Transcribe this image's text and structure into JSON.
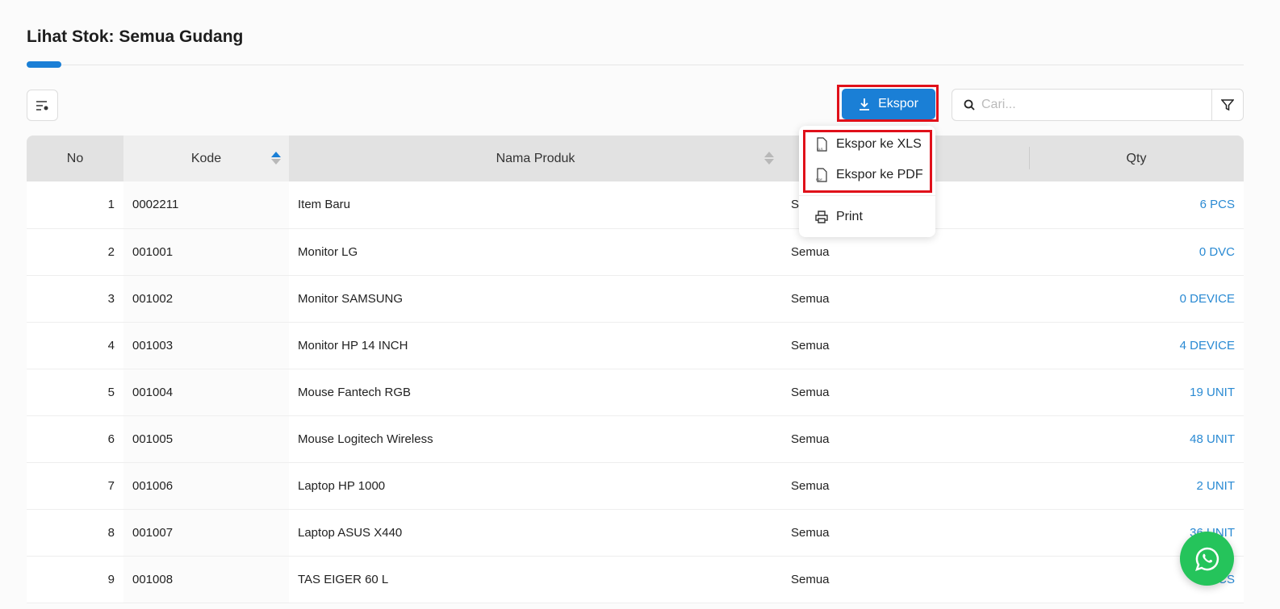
{
  "page": {
    "title": "Lihat Stok: Semua Gudang"
  },
  "toolbar": {
    "export_label": "Ekspor",
    "search_placeholder": "Cari...",
    "accent": "#1a7fd6"
  },
  "export_menu": {
    "items": [
      {
        "label": "Ekspor ke XLS",
        "icon": "xls-file-icon"
      },
      {
        "label": "Ekspor ke PDF",
        "icon": "pdf-file-icon"
      },
      {
        "label": "Print",
        "icon": "printer-icon"
      }
    ]
  },
  "table": {
    "headers": [
      "No",
      "Kode",
      "Nama Produk",
      "",
      "Qty"
    ],
    "rows": [
      [
        "1",
        "0002211",
        "Item Baru",
        "Semua",
        "6 PCS"
      ],
      [
        "2",
        "001001",
        "Monitor LG",
        "Semua",
        "0 DVC"
      ],
      [
        "3",
        "001002",
        "Monitor SAMSUNG",
        "Semua",
        "0 DEVICE"
      ],
      [
        "4",
        "001003",
        "Monitor HP 14 INCH",
        "Semua",
        "4 DEVICE"
      ],
      [
        "5",
        "001004",
        "Mouse Fantech RGB",
        "Semua",
        "19 UNIT"
      ],
      [
        "6",
        "001005",
        "Mouse Logitech Wireless",
        "Semua",
        "48 UNIT"
      ],
      [
        "7",
        "001006",
        "Laptop HP 1000",
        "Semua",
        "2 UNIT"
      ],
      [
        "8",
        "001007",
        "Laptop ASUS X440",
        "Semua",
        "36 UNIT"
      ],
      [
        "9",
        "001008",
        "TAS EIGER 60 L",
        "Semua",
        "PCS"
      ]
    ]
  }
}
